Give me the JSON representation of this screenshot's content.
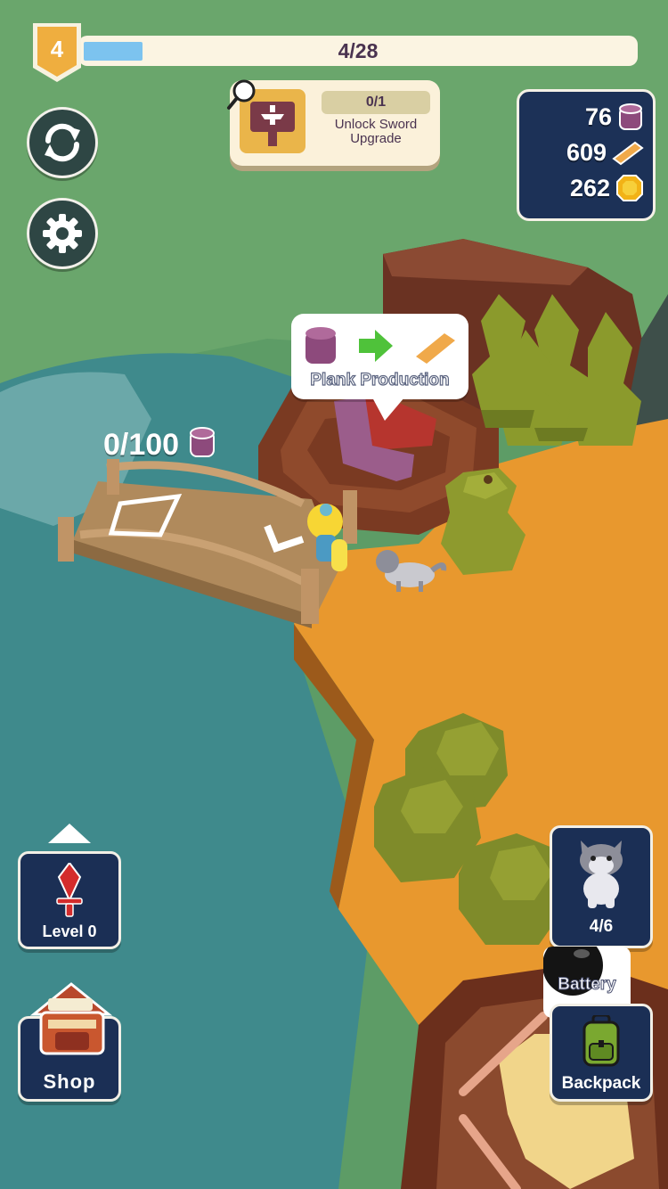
{
  "level": {
    "number": "4",
    "progress_text": "4/28",
    "progress_fraction": 0.107
  },
  "quest": {
    "progress": "0/1",
    "title": "Unlock Sword Upgrade",
    "icon": "anvil-sign-icon"
  },
  "resources": [
    {
      "value": "76",
      "icon": "log-icon"
    },
    {
      "value": "609",
      "icon": "plank-icon"
    },
    {
      "value": "262",
      "icon": "coin-icon"
    }
  ],
  "buttons": {
    "refresh_icon": "refresh-icon",
    "settings_icon": "gear-icon"
  },
  "plank_production": {
    "label": "Plank Production"
  },
  "bridge": {
    "counter": "0/100"
  },
  "sword": {
    "label": "Level 0"
  },
  "shop": {
    "label": "Shop"
  },
  "pet": {
    "count": "4/6"
  },
  "battery": {
    "label": "Battery"
  },
  "backpack": {
    "label": "Backpack"
  },
  "colors": {
    "panel": "#1b2f55",
    "ground": "#e8982e",
    "water": "#3f8a8c",
    "accent_gold": "#eab54a"
  }
}
